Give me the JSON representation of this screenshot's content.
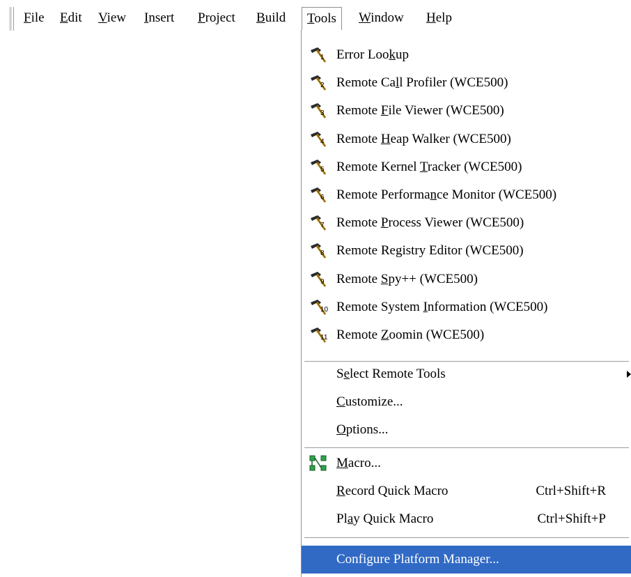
{
  "menubar": {
    "items": [
      {
        "pre": "",
        "key": "F",
        "post": "ile"
      },
      {
        "pre": "",
        "key": "E",
        "post": "dit"
      },
      {
        "pre": "",
        "key": "V",
        "post": "iew"
      },
      {
        "pre": "",
        "key": "I",
        "post": "nsert"
      },
      {
        "pre": "",
        "key": "P",
        "post": "roject"
      },
      {
        "pre": "",
        "key": "B",
        "post": "uild"
      },
      {
        "pre": "",
        "key": "T",
        "post": "ools"
      },
      {
        "pre": "",
        "key": "W",
        "post": "indow"
      },
      {
        "pre": "",
        "key": "H",
        "post": "elp"
      }
    ]
  },
  "tools_menu": {
    "remote_tools": [
      {
        "pre": "Error Loo",
        "key": "k",
        "post": "up",
        "icon_number": "1"
      },
      {
        "pre": "Remote Ca",
        "key": "l",
        "post": "l Profiler (WCE500)",
        "icon_number": "2"
      },
      {
        "pre": "Remote ",
        "key": "F",
        "post": "ile Viewer (WCE500)",
        "icon_number": "3"
      },
      {
        "pre": "Remote ",
        "key": "H",
        "post": "eap Walker (WCE500)",
        "icon_number": "4"
      },
      {
        "pre": "Remote Kernel ",
        "key": "T",
        "post": "racker (WCE500)",
        "icon_number": "5"
      },
      {
        "pre": "Remote Performa",
        "key": "n",
        "post": "ce Monitor (WCE500)",
        "icon_number": "6"
      },
      {
        "pre": "Remote ",
        "key": "P",
        "post": "rocess Viewer (WCE500)",
        "icon_number": "7"
      },
      {
        "pre": "Remote Registry Editor (WCE500)",
        "key": "",
        "post": "",
        "icon_number": "8"
      },
      {
        "pre": "Remote ",
        "key": "S",
        "post": "py++ (WCE500)",
        "icon_number": "9"
      },
      {
        "pre": "Remote System ",
        "key": "I",
        "post": "nformation (WCE500)",
        "icon_number": "10"
      },
      {
        "pre": "Remote ",
        "key": "Z",
        "post": "oomin (WCE500)",
        "icon_number": "11"
      }
    ],
    "select_remote_tools": {
      "pre": "S",
      "key": "e",
      "post": "lect Remote Tools"
    },
    "customize": {
      "pre": "",
      "key": "C",
      "post": "ustomize..."
    },
    "options": {
      "pre": "",
      "key": "O",
      "post": "ptions..."
    },
    "macro": {
      "pre": "",
      "key": "M",
      "post": "acro..."
    },
    "record_quick_macro": {
      "pre": "",
      "key": "R",
      "post": "ecord Quick Macro",
      "shortcut": "Ctrl+Shift+R"
    },
    "play_quick_macro": {
      "pre": "Pl",
      "key": "a",
      "post": "y Quick Macro",
      "shortcut": "Ctrl+Shift+P"
    },
    "configure_platform_manager": {
      "pre": "Confi",
      "key": "g",
      "post": "ure Platform Manager..."
    }
  },
  "colors": {
    "highlight": "#316ac5",
    "hammer_head": "#2b2b2b",
    "hammer_handle": "#c8961e",
    "macro_icon_green": "#2fa34a"
  },
  "icons": {
    "remote_tool": "hammer-icon",
    "macro": "macro-icon",
    "submenu": "submenu-arrow-icon"
  }
}
